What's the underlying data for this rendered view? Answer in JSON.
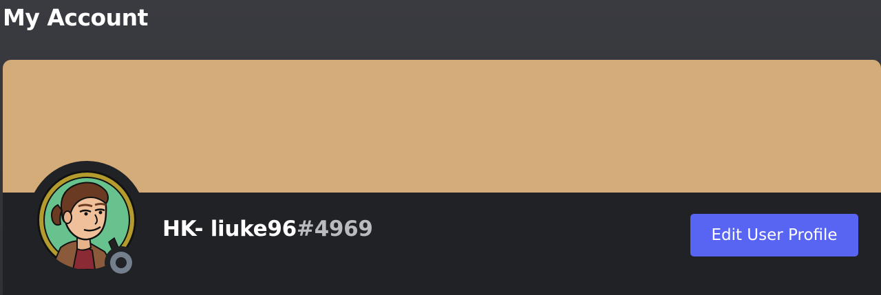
{
  "page": {
    "title": "My Account"
  },
  "profile": {
    "banner_color": "#d4ac79",
    "username": "HK- liuke96",
    "discriminator": "#4969",
    "status": "offline",
    "status_color": "#747f8d",
    "avatar_icon": "cartoon-man-avatar",
    "edit_button_label": "Edit User Profile",
    "edit_button_color": "#5865f2"
  }
}
